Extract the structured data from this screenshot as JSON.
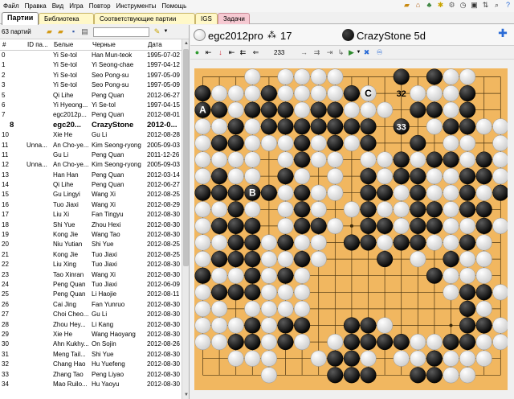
{
  "menu": [
    "Файл",
    "Правка",
    "Вид",
    "Игра",
    "Повтор",
    "Инструменты",
    "Помощь"
  ],
  "tray_icons": [
    "folder-icon",
    "home-icon",
    "tree-icon",
    "star-icon",
    "settings-icon",
    "clock-icon",
    "monitor-icon",
    "sort-icon",
    "search-icon",
    "help-icon"
  ],
  "tabs": [
    {
      "label": "Партии",
      "active": true
    },
    {
      "label": "Библиотека"
    },
    {
      "label": "Соответствующие партии"
    },
    {
      "label": "IGS"
    },
    {
      "label": "Задачи"
    }
  ],
  "games_panel": {
    "count_label": "63 партий",
    "filter_value": ""
  },
  "table": {
    "headers": {
      "num": "#",
      "id": "ID па...",
      "white": "Белые",
      "black": "Черные",
      "date": "Дата"
    },
    "selected_index": 8,
    "rows": [
      [
        "0",
        "",
        "Yi Se-tol",
        "Han Mun-teok",
        "1995-07-02"
      ],
      [
        "1",
        "",
        "Yi Se-tol",
        "Yi Seong-chae",
        "1997-04-12"
      ],
      [
        "2",
        "",
        "Yi Se-tol",
        "Seo Pong-su",
        "1997-05-09"
      ],
      [
        "3",
        "",
        "Yi Se-tol",
        "Seo Pong-su",
        "1997-05-09"
      ],
      [
        "5",
        "",
        "Qi Lihe",
        "Peng Quan",
        "2012-06-27"
      ],
      [
        "6",
        "",
        "Yi Hyeong...",
        "Yi Se-tol",
        "1997-04-15"
      ],
      [
        "7",
        "",
        "egc2012p...",
        "Peng Quan",
        "2012-08-01"
      ],
      [
        "8",
        "",
        "egc20...",
        "CrazyStone",
        "2012-0..."
      ],
      [
        "10",
        "",
        "Xie He",
        "Gu Li",
        "2012-08-28"
      ],
      [
        "11",
        "Unna...",
        "An Cho-ye...",
        "Kim Seong-ryong",
        "2005-09-03"
      ],
      [
        "11",
        "",
        "Gu Li",
        "Peng Quan",
        "2011-12-26"
      ],
      [
        "12",
        "Unna...",
        "An Cho-ye...",
        "Kim Seong-ryong",
        "2005-09-03"
      ],
      [
        "13",
        "",
        "Han Han",
        "Peng Quan",
        "2012-03-14"
      ],
      [
        "14",
        "",
        "Qi Lihe",
        "Peng Quan",
        "2012-06-27"
      ],
      [
        "15",
        "",
        "Gu Lingyi",
        "Wang Xi",
        "2012-08-25"
      ],
      [
        "16",
        "",
        "Tuo Jiaxi",
        "Wang Xi",
        "2012-08-29"
      ],
      [
        "17",
        "",
        "Liu Xi",
        "Fan Tingyu",
        "2012-08-30"
      ],
      [
        "18",
        "",
        "Shi Yue",
        "Zhou Hexi",
        "2012-08-30"
      ],
      [
        "19",
        "",
        "Kong Jie",
        "Wang Tao",
        "2012-08-30"
      ],
      [
        "20",
        "",
        "Niu Yutian",
        "Shi Yue",
        "2012-08-25"
      ],
      [
        "21",
        "",
        "Kong Jie",
        "Tuo Jiaxi",
        "2012-08-25"
      ],
      [
        "22",
        "",
        "Liu Xing",
        "Tuo Jiaxi",
        "2012-08-30"
      ],
      [
        "23",
        "",
        "Tao Xinran",
        "Wang Xi",
        "2012-08-30"
      ],
      [
        "24",
        "",
        "Peng Quan",
        "Tuo Jiaxi",
        "2012-06-09"
      ],
      [
        "25",
        "",
        "Peng Quan",
        "Li Haojie",
        "2012-08-11"
      ],
      [
        "26",
        "",
        "Cai Jing",
        "Fan Yunruo",
        "2012-08-30"
      ],
      [
        "27",
        "",
        "Choi Cheo...",
        "Gu Li",
        "2012-08-30"
      ],
      [
        "28",
        "",
        "Zhou Hey...",
        "Li Kang",
        "2012-08-30"
      ],
      [
        "29",
        "",
        "Xie He",
        "Wang Haoyang",
        "2012-08-30"
      ],
      [
        "30",
        "",
        "Ahn Kukhy...",
        "On Sojin",
        "2012-08-26"
      ],
      [
        "31",
        "",
        "Meng Tail...",
        "Shi Yue",
        "2012-08-30"
      ],
      [
        "32",
        "",
        "Chang Hao",
        "Hu Yuefeng",
        "2012-08-30"
      ],
      [
        "33",
        "",
        "Zhang Tao",
        "Peng Liyao",
        "2012-08-30"
      ],
      [
        "34",
        "",
        "Mao Ruilo...",
        "Hu Yaoyu",
        "2012-08-30"
      ]
    ]
  },
  "players": {
    "white": "egc2012pro",
    "black": "CrazyStone 5d",
    "captures": "17"
  },
  "board_toolbar": {
    "move_number": "233"
  },
  "board": {
    "size": 19,
    "rows": [
      "...W.WWWW...B.BWW..",
      "BWWWBWWWWBW..WWWB..",
      "BBWBBBWBBWWW.BBWB..",
      "WWBWBBBBBBB.B.WBBWW",
      "WBBWWWBWBWB..B.WW.W",
      "WWWW.WBWW.WWBWBBWBW",
      "WBWW.BW.W.BWBBWWBBW",
      "BBBBBWBWW.BBWBWWBWB",
      "WWBW.WBW.WBWWBBWBB.",
      "WBBB.WBBW.BBWBBWWBW",
      "WWBBWBWW.BBWBBWWBW.",
      "WBBBWWBW...B.W.BWW.",
      "BWWBWBW.......BWWW.",
      "WBBBWWW........WBBW",
      "WW.WWWW.........BW.",
      "WWWBWBB..BBW....BBW",
      "WWBBWBW.WBBBBWWBBWW",
      "..WWW..WBBW.WWBWWW.",
      "....W...BBB..BBWW.."
    ],
    "labels": [
      {
        "text": "A",
        "row": 2,
        "col": 0
      },
      {
        "text": "C",
        "row": 1,
        "col": 10
      },
      {
        "text": "32",
        "row": 1,
        "col": 12
      },
      {
        "text": "33",
        "row": 3,
        "col": 12
      },
      {
        "text": "B",
        "row": 7,
        "col": 3
      }
    ]
  },
  "colors": {
    "board": "#f1b760",
    "tab_yellow": "#fff8c8",
    "tab_pink": "#f6c9d2",
    "accent_blue": "#2a6bd6"
  }
}
